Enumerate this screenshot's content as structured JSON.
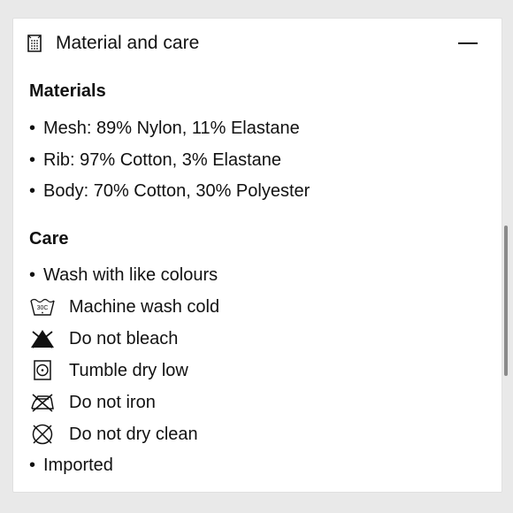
{
  "section": {
    "title": "Material and care",
    "header_icon": "fabric-label-icon",
    "collapse_icon": "minus-icon"
  },
  "materials": {
    "heading": "Materials",
    "items": [
      "Mesh: 89% Nylon, 11% Elastane",
      "Rib: 97% Cotton, 3% Elastane",
      "Body: 70% Cotton, 30% Polyester"
    ]
  },
  "care": {
    "heading": "Care",
    "items": [
      {
        "icon": "bullet",
        "text": "Wash with like colours"
      },
      {
        "icon": "wash-30c-icon",
        "icon_text": "30C",
        "text": "Machine wash cold"
      },
      {
        "icon": "do-not-bleach-icon",
        "text": "Do not bleach"
      },
      {
        "icon": "tumble-dry-low-icon",
        "text": "Tumble dry low"
      },
      {
        "icon": "do-not-iron-icon",
        "text": "Do not iron"
      },
      {
        "icon": "do-not-dry-clean-icon",
        "text": "Do not dry clean"
      },
      {
        "icon": "bullet",
        "text": "Imported"
      }
    ]
  },
  "bullet_char": "•"
}
